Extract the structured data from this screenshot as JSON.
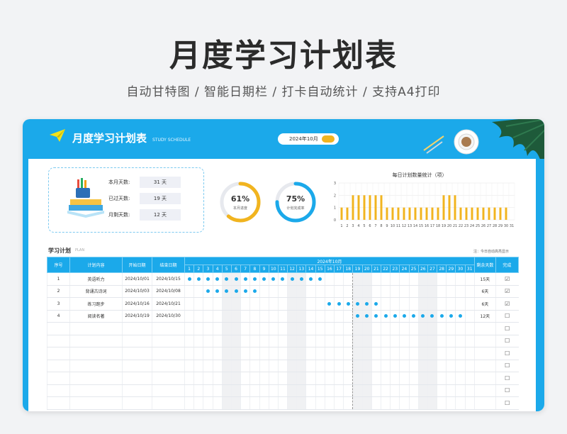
{
  "hero": {
    "title": "月度学习计划表",
    "subtitle": "自动甘特图 / 智能日期栏 / 打卡自动统计 / 支持A4打印"
  },
  "colors": {
    "accent": "#1ba9ea",
    "ring_yellow": "#f1b41f",
    "bar_yellow": "#f1b41f"
  },
  "header": {
    "title": "月度学习计划表",
    "subtitle": "STUDY SCHEDULE",
    "month": "2024年10月"
  },
  "summary": {
    "items": [
      {
        "label": "本月天数:",
        "value": "31 天"
      },
      {
        "label": "已过天数:",
        "value": "19 天"
      },
      {
        "label": "月剩天数:",
        "value": "12 天"
      }
    ]
  },
  "rings": [
    {
      "pct_text": "61%",
      "caption": "本月进度",
      "value": 0.61,
      "color": "#f1b41f"
    },
    {
      "pct_text": "75%",
      "caption": "计划完成率",
      "value": 0.75,
      "color": "#1ba9ea"
    }
  ],
  "chart_data": {
    "type": "bar",
    "title": "每日计划数量统计（项）",
    "categories": [
      "1",
      "2",
      "3",
      "4",
      "5",
      "6",
      "7",
      "8",
      "9",
      "10",
      "11",
      "12",
      "13",
      "14",
      "15",
      "16",
      "17",
      "18",
      "19",
      "20",
      "21",
      "22",
      "23",
      "24",
      "25",
      "26",
      "27",
      "28",
      "29",
      "30",
      "31"
    ],
    "values": [
      1,
      1,
      2,
      2,
      2,
      2,
      2,
      2,
      1,
      1,
      1,
      1,
      1,
      1,
      1,
      1,
      1,
      1,
      2,
      2,
      2,
      1,
      1,
      1,
      1,
      1,
      1,
      1,
      1,
      1,
      0
    ],
    "ylim": [
      0,
      3
    ],
    "yticks": [
      "0",
      "1",
      "2",
      "3"
    ],
    "grid": true
  },
  "plan": {
    "title": "学习计划",
    "title_en": "PLAN",
    "note": "注：今日自动高亮显示",
    "month_label": "2024年10月",
    "headers": {
      "no": "序号",
      "content": "计划内容",
      "start": "开始日期",
      "end": "结束日期",
      "remain": "剩余天数",
      "done": "完成"
    },
    "days": [
      "1",
      "2",
      "3",
      "4",
      "5",
      "6",
      "7",
      "8",
      "9",
      "10",
      "11",
      "12",
      "13",
      "14",
      "15",
      "16",
      "17",
      "18",
      "19",
      "20",
      "21",
      "22",
      "23",
      "24",
      "25",
      "26",
      "27",
      "28",
      "29",
      "30",
      "31"
    ],
    "today": 19,
    "weekend_days": [
      5,
      6,
      12,
      13,
      19,
      20,
      26,
      27
    ],
    "rows": [
      {
        "no": "1",
        "content": "英语听力",
        "start": "2024/10/01",
        "end": "2024/10/15",
        "remain": "15天",
        "done": "☑",
        "range": [
          1,
          15
        ]
      },
      {
        "no": "2",
        "content": "背诵古诗词",
        "start": "2024/10/03",
        "end": "2024/10/08",
        "remain": "6天",
        "done": "☑",
        "range": [
          3,
          8
        ]
      },
      {
        "no": "3",
        "content": "练习跑步",
        "start": "2024/10/16",
        "end": "2024/10/21",
        "remain": "6天",
        "done": "☑",
        "range": [
          16,
          21
        ]
      },
      {
        "no": "4",
        "content": "阅读名著",
        "start": "2024/10/19",
        "end": "2024/10/30",
        "remain": "12天",
        "done": "☐",
        "range": [
          19,
          30
        ]
      },
      {
        "no": "",
        "content": "",
        "start": "",
        "end": "",
        "remain": "",
        "done": "☐",
        "range": null
      },
      {
        "no": "",
        "content": "",
        "start": "",
        "end": "",
        "remain": "",
        "done": "☐",
        "range": null
      },
      {
        "no": "",
        "content": "",
        "start": "",
        "end": "",
        "remain": "",
        "done": "☐",
        "range": null
      },
      {
        "no": "",
        "content": "",
        "start": "",
        "end": "",
        "remain": "",
        "done": "☐",
        "range": null
      },
      {
        "no": "",
        "content": "",
        "start": "",
        "end": "",
        "remain": "",
        "done": "☐",
        "range": null
      },
      {
        "no": "",
        "content": "",
        "start": "",
        "end": "",
        "remain": "",
        "done": "☐",
        "range": null
      },
      {
        "no": "",
        "content": "",
        "start": "",
        "end": "",
        "remain": "",
        "done": "☐",
        "range": null
      }
    ]
  },
  "icons": [
    "paper-plane-icon",
    "toggle-icon",
    "pen-icon",
    "coffee-cup-icon",
    "palm-leaf-icon",
    "books-illustration"
  ]
}
